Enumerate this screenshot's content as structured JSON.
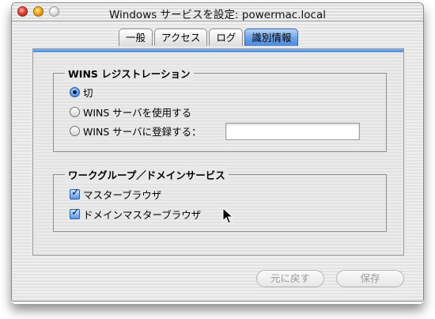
{
  "window": {
    "title": "Windows サービスを設定: powermac.local"
  },
  "tabs": [
    {
      "label": "一般",
      "selected": false
    },
    {
      "label": "アクセス",
      "selected": false
    },
    {
      "label": "ログ",
      "selected": false
    },
    {
      "label": "識別情報",
      "selected": true
    }
  ],
  "wins": {
    "heading": "WINS レジストレーション",
    "options": [
      {
        "label": "切",
        "selected": true
      },
      {
        "label": "WINS サーバを使用する",
        "selected": false
      },
      {
        "label": "WINS サーバに登録する：",
        "selected": false
      }
    ],
    "server_value": ""
  },
  "workgroup": {
    "heading": "ワークグループ／ドメインサービス",
    "options": [
      {
        "label": "マスターブラウザ",
        "checked": true
      },
      {
        "label": "ドメインマスターブラウザ",
        "checked": true
      }
    ]
  },
  "buttons": {
    "revert": "元に戻す",
    "save": "保存"
  },
  "colors": {
    "accent": "#5a96e0",
    "selected_tab": "#6aa0e6"
  }
}
